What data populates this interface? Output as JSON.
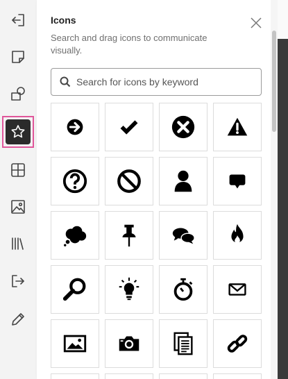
{
  "panel": {
    "title": "Icons",
    "subtitle": "Search and drag icons to communicate visually.",
    "search_placeholder": "Search for icons by keyword"
  },
  "rail": {
    "items": [
      "exit-icon",
      "sticky-note-icon",
      "shapes-icon",
      "star-icon",
      "layout-grid-icon",
      "image-icon",
      "library-icon",
      "import-icon",
      "pencil-icon"
    ],
    "active": "star-icon",
    "active_border_color": "#e0569a"
  },
  "icons": [
    "arrow-right-circle-icon",
    "checkmark-icon",
    "close-circle-icon",
    "warning-icon",
    "question-circle-icon",
    "no-entry-icon",
    "user-icon",
    "speech-bubble-icon",
    "thought-cloud-icon",
    "pushpin-icon",
    "chat-bubbles-icon",
    "fire-icon",
    "magnifier-icon",
    "lightbulb-icon",
    "stopwatch-icon",
    "envelope-icon",
    "picture-icon",
    "camera-icon",
    "documents-icon",
    "link-icon"
  ]
}
